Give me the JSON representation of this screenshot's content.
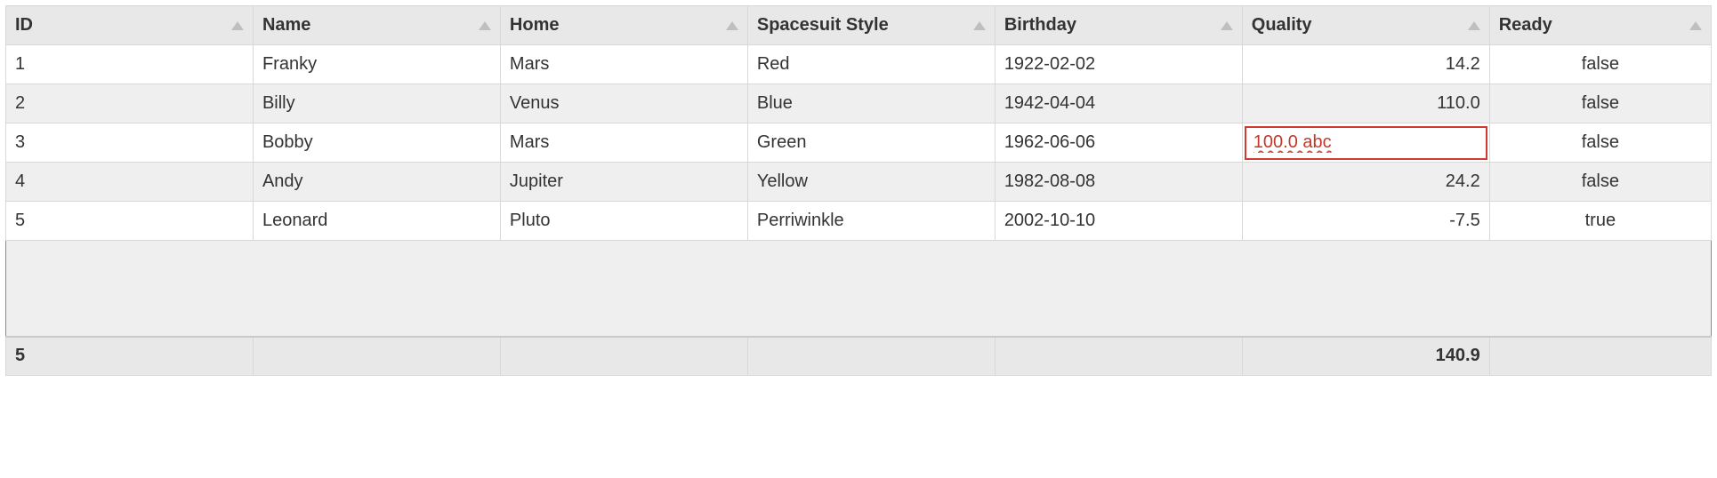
{
  "columns": [
    {
      "key": "id",
      "label": "ID",
      "align": "left"
    },
    {
      "key": "name",
      "label": "Name",
      "align": "left"
    },
    {
      "key": "home",
      "label": "Home",
      "align": "left"
    },
    {
      "key": "style",
      "label": "Spacesuit Style",
      "align": "left"
    },
    {
      "key": "birthday",
      "label": "Birthday",
      "align": "left"
    },
    {
      "key": "quality",
      "label": "Quality",
      "align": "right"
    },
    {
      "key": "ready",
      "label": "Ready",
      "align": "center"
    }
  ],
  "rows": [
    {
      "id": "1",
      "name": "Franky",
      "home": "Mars",
      "style": "Red",
      "birthday": "1922-02-02",
      "quality": "14.2",
      "ready": "false"
    },
    {
      "id": "2",
      "name": "Billy",
      "home": "Venus",
      "style": "Blue",
      "birthday": "1942-04-04",
      "quality": "110.0",
      "ready": "false"
    },
    {
      "id": "3",
      "name": "Bobby",
      "home": "Mars",
      "style": "Green",
      "birthday": "1962-06-06",
      "quality": "100.0 abc",
      "quality_invalid": true,
      "ready": "false"
    },
    {
      "id": "4",
      "name": "Andy",
      "home": "Jupiter",
      "style": "Yellow",
      "birthday": "1982-08-08",
      "quality": "24.2",
      "ready": "false"
    },
    {
      "id": "5",
      "name": "Leonard",
      "home": "Pluto",
      "style": "Perriwinkle",
      "birthday": "2002-10-10",
      "quality": "-7.5",
      "ready": "true"
    }
  ],
  "footer": {
    "count": "5",
    "quality_sum": "140.9"
  }
}
